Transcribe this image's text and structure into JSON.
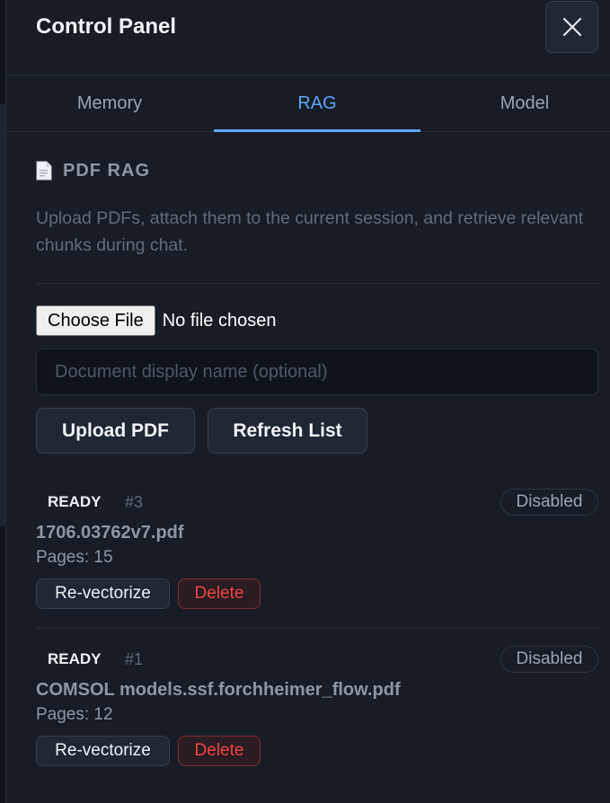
{
  "panel": {
    "title": "Control Panel"
  },
  "tabs": [
    {
      "label": "Memory",
      "active": false
    },
    {
      "label": "RAG",
      "active": true
    },
    {
      "label": "Model",
      "active": false
    }
  ],
  "rag": {
    "section_title": "PDF RAG",
    "section_icon": "document-icon",
    "description": "Upload PDFs, attach them to the current session, and retrieve relevant chunks during chat.",
    "file_input": {
      "button_label": "Choose File",
      "status": "No file chosen"
    },
    "display_name_input": {
      "value": "",
      "placeholder": "Document display name (optional)"
    },
    "upload_button": "Upload PDF",
    "refresh_button": "Refresh List",
    "documents": [
      {
        "status": "READY",
        "id": "#3",
        "state": "Disabled",
        "name": "1706.03762v7.pdf",
        "pages": "Pages: 15",
        "revectorize_label": "Re-vectorize",
        "delete_label": "Delete"
      },
      {
        "status": "READY",
        "id": "#1",
        "state": "Disabled",
        "name": "COMSOL models.ssf.forchheimer_flow.pdf",
        "pages": "Pages: 12",
        "revectorize_label": "Re-vectorize",
        "delete_label": "Delete"
      }
    ]
  },
  "colors": {
    "accent": "#60a5fa",
    "danger": "#ef4444",
    "panel_bg": "#181d25"
  }
}
